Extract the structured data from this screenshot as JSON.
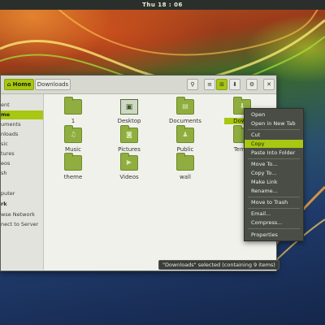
{
  "topbar": {
    "clock": "Thu 18 : 06"
  },
  "toolbar": {
    "home_label": "Home",
    "downloads_label": "Downloads"
  },
  "sidebar": {
    "items": [
      "ent",
      "me",
      "uments",
      "nloads",
      "sic",
      "tures",
      "eos",
      "sh",
      "puter",
      "rk",
      "wse Network",
      "nect to Server"
    ]
  },
  "files": {
    "items": [
      "1",
      "Desktop",
      "Documents",
      "Downl",
      "Music",
      "Pictures",
      "Public",
      "Templ",
      "theme",
      "Videos",
      "wall"
    ]
  },
  "menu": {
    "items": [
      "Open",
      "Open in New Tab",
      "Cut",
      "Copy",
      "Paste Into Folder",
      "Move To...",
      "Copy To...",
      "Make Link",
      "Rename...",
      "Move to Trash",
      "Email...",
      "Compress...",
      "Properties"
    ]
  },
  "status": {
    "text": "\"Downloads\" selected (containing 9 items)"
  },
  "colors": {
    "accent": "#a7c713",
    "menu_bg": "#4a4d46"
  }
}
